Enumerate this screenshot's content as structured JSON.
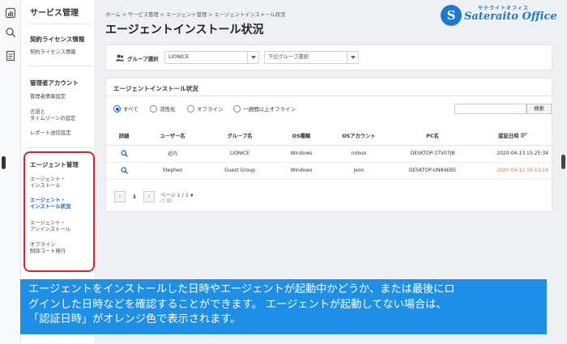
{
  "sidebar": {
    "title": "サービス管理",
    "sections": [
      {
        "heading": "契約ライセンス情報",
        "items": [
          "契約ライセンス情報"
        ]
      },
      {
        "heading": "管理者アカウント",
        "items": [
          "管理者情報設定",
          "言語と\nタイムゾーンの設定",
          "レポート送信設定"
        ]
      },
      {
        "heading": "エージェント管理",
        "items": [
          "エージェント・\nインストール",
          "エージェント・\nインストール状況",
          "エージェント・\nアンインストール",
          "オフライン\n削除コード発行"
        ]
      }
    ]
  },
  "breadcrumb": "ホーム > サービス管理 > エージェント管理 > エージェントインストール状況",
  "page_title": "エージェントインストール状況",
  "logo": {
    "small": "サテライトオフィス",
    "big": "Sateraito Office",
    "mark": "S"
  },
  "filter": {
    "label": "グループ選択",
    "group_value": "LIONICE",
    "subgroup_placeholder": "下位グループ選択"
  },
  "status": {
    "title": "エージェントインストール状況",
    "radios": [
      "すべて",
      "活性化",
      "オフライン",
      "一週間以上オフライン"
    ],
    "selected": 0,
    "search_button": "検索",
    "columns": [
      "詳細",
      "ユーザー名",
      "グループ名",
      "OS種類",
      "OSアカウント",
      "PC名",
      "認証日時"
    ],
    "rows": [
      {
        "user": "近内",
        "group": "LIONICE",
        "os": "Windows",
        "account": "nobuo",
        "pc": "DESKTOP-1TV07J8",
        "date": "2020-04-13 15:25:34",
        "offline": false
      },
      {
        "user": "Stephen",
        "group": "Guest Group",
        "os": "Windows",
        "account": "Jeon",
        "pc": "DESKTOP-UN84EB5",
        "date": "2020-04-12 16:13:14",
        "offline": true
      }
    ],
    "pagination": {
      "current": "1",
      "page_text": "ページ 1 / 1",
      "count_text": "(2 個)"
    }
  },
  "caption": {
    "lines": [
      "エージェントをインストールした日時やエージェントが起動中かどうか、または最後にロ",
      "グインした日時などを確認することができます。 エージェントが起動してない場合は、",
      "「認証日時」がオレンジ色で表示されます。"
    ]
  },
  "colors": {
    "accent": "#1b5fb3",
    "highlight_box": "#d9232e",
    "caption_bg": "#1e8fe6",
    "offline_date": "#e4741f"
  }
}
